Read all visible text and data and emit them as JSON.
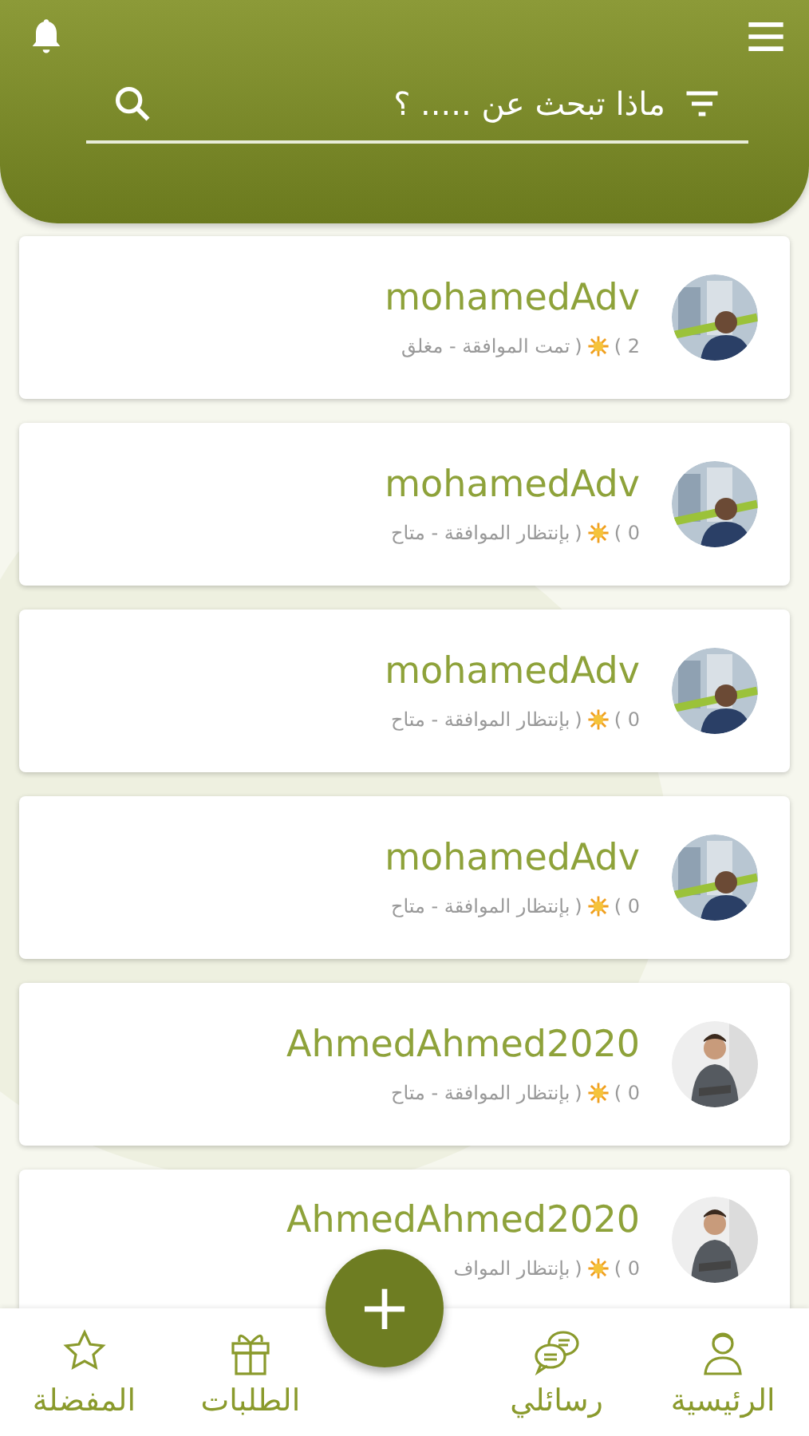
{
  "header": {
    "search": {
      "placeholder": "ماذا تبحث عن ..... ؟"
    }
  },
  "cards": [
    {
      "name": "mohamedAdv",
      "count": "( 2",
      "close": ")",
      "status": "تمت الموافقة - مغلق"
    },
    {
      "name": "mohamedAdv",
      "count": "( 0",
      "close": ")",
      "status": "بإنتظار الموافقة - متاح"
    },
    {
      "name": "mohamedAdv",
      "count": "( 0",
      "close": ")",
      "status": "بإنتظار الموافقة - متاح"
    },
    {
      "name": "mohamedAdv",
      "count": "( 0",
      "close": ")",
      "status": "بإنتظار الموافقة - متاح"
    },
    {
      "name": "AhmedAhmed2020",
      "count": "( 0",
      "close": ")",
      "status": "بإنتظار الموافقة - متاح"
    },
    {
      "name": "AhmedAhmed2020",
      "count": "( 0",
      "close": ")",
      "status": "بإنتظار المواف"
    }
  ],
  "fab": {
    "label": "+"
  },
  "nav": [
    {
      "label": "الرئيسية",
      "kind": "user"
    },
    {
      "label": "رسائلي",
      "kind": "chat"
    },
    {
      "label": "الطلبات",
      "kind": "gift"
    },
    {
      "label": "المفضلة",
      "kind": "star"
    }
  ]
}
